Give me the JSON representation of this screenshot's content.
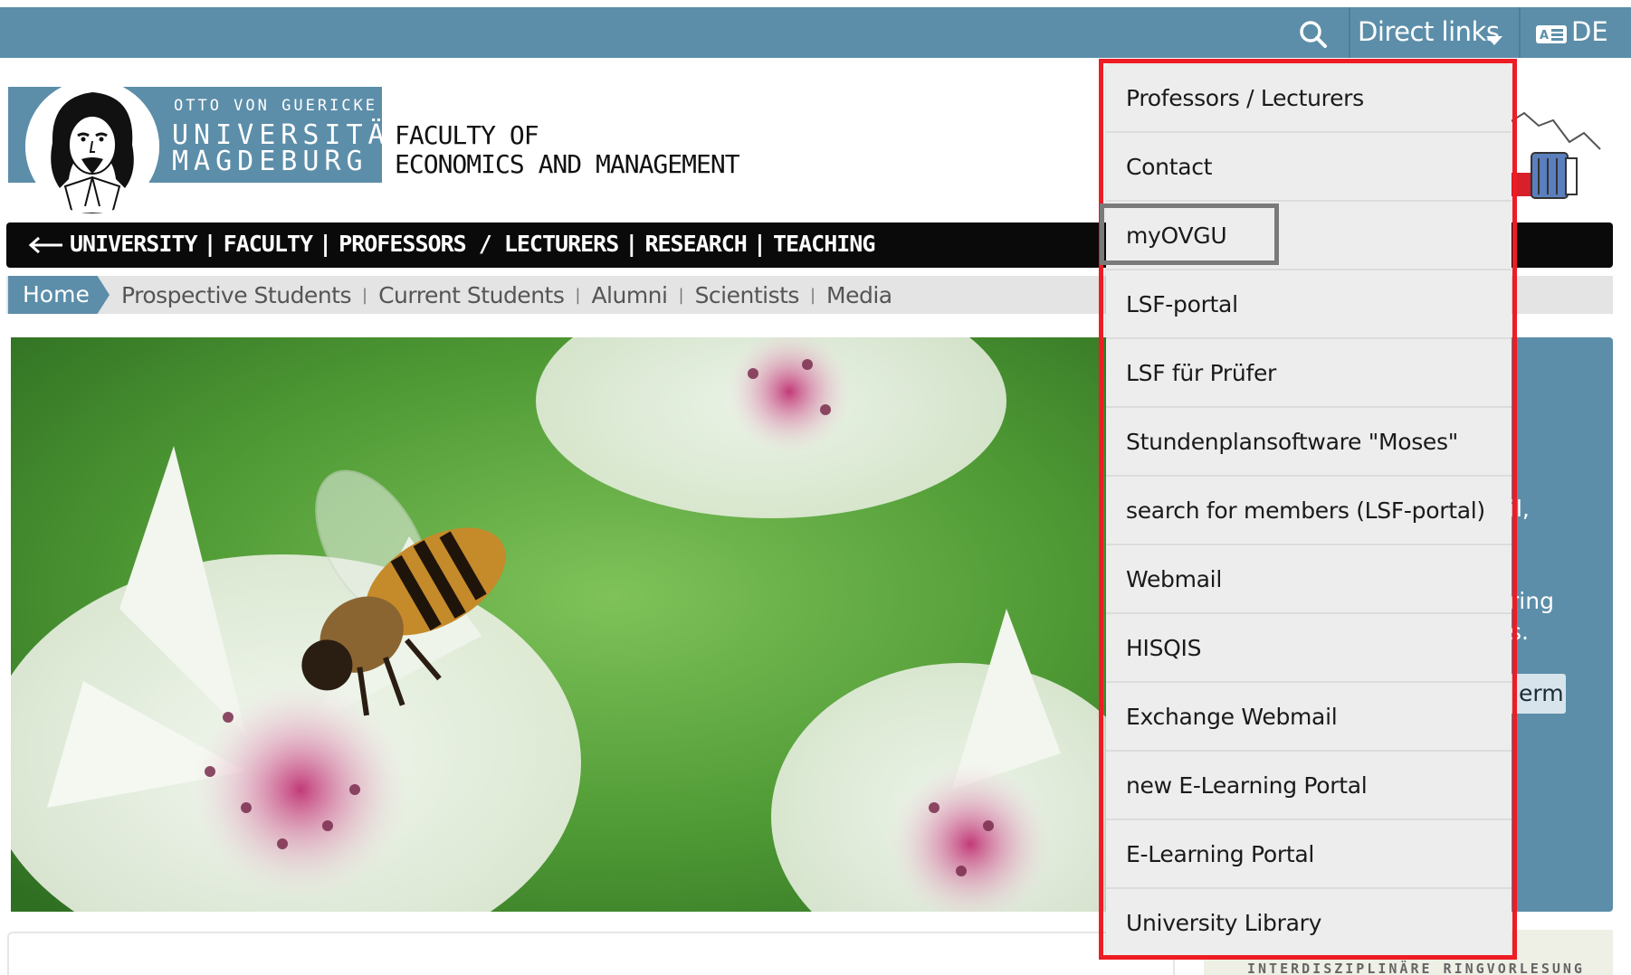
{
  "topbar": {
    "search_icon": "search-icon",
    "direct_links_label": "Direct links",
    "language_label": "DE",
    "language_icon": "keyboard-flag-icon"
  },
  "header": {
    "logo_line_small": "OTTO VON GUERICKE",
    "logo_line_1": "UNIVERSITÄT",
    "logo_line_2": "MAGDEBURG",
    "faculty_line_1": "FACULTY OF",
    "faculty_line_2": "ECONOMICS AND MANAGEMENT"
  },
  "main_nav": {
    "back_icon": "arrow-left-icon",
    "items": [
      "UNIVERSITY",
      "FACULTY",
      "PROFESSORS / LECTURERS",
      "RESEARCH",
      "TEACHING"
    ]
  },
  "breadcrumb": {
    "home": "Home",
    "items": [
      "Prospective Students",
      "Current Students",
      "Alumni",
      "Scientists",
      "Media"
    ]
  },
  "side_panel": {
    "fragment_1": "il,",
    "fragment_2": "ring",
    "fragment_3": "s.",
    "button_fragment": "erm"
  },
  "dropdown": {
    "items": [
      "Professors / Lecturers",
      "Contact",
      "myOVGU",
      "LSF-portal",
      "LSF für Prüfer",
      "Stundenplansoftware \"Moses\"",
      "search for members (LSF-portal)",
      "Webmail",
      "HISQIS",
      "Exchange Webmail",
      "new E-Learning Portal",
      "E-Learning Portal",
      "University Library"
    ],
    "highlighted_item": "myOVGU"
  },
  "bottom": {
    "thumbnail_text": "INTERDISZIPLINÄRE RINGVORLESUNG"
  },
  "colors": {
    "brand_blue": "#5c8ea9",
    "nav_black": "#0a0a0a",
    "annotation_red": "#ee1c24",
    "annotation_gray": "#7a7a7a"
  }
}
